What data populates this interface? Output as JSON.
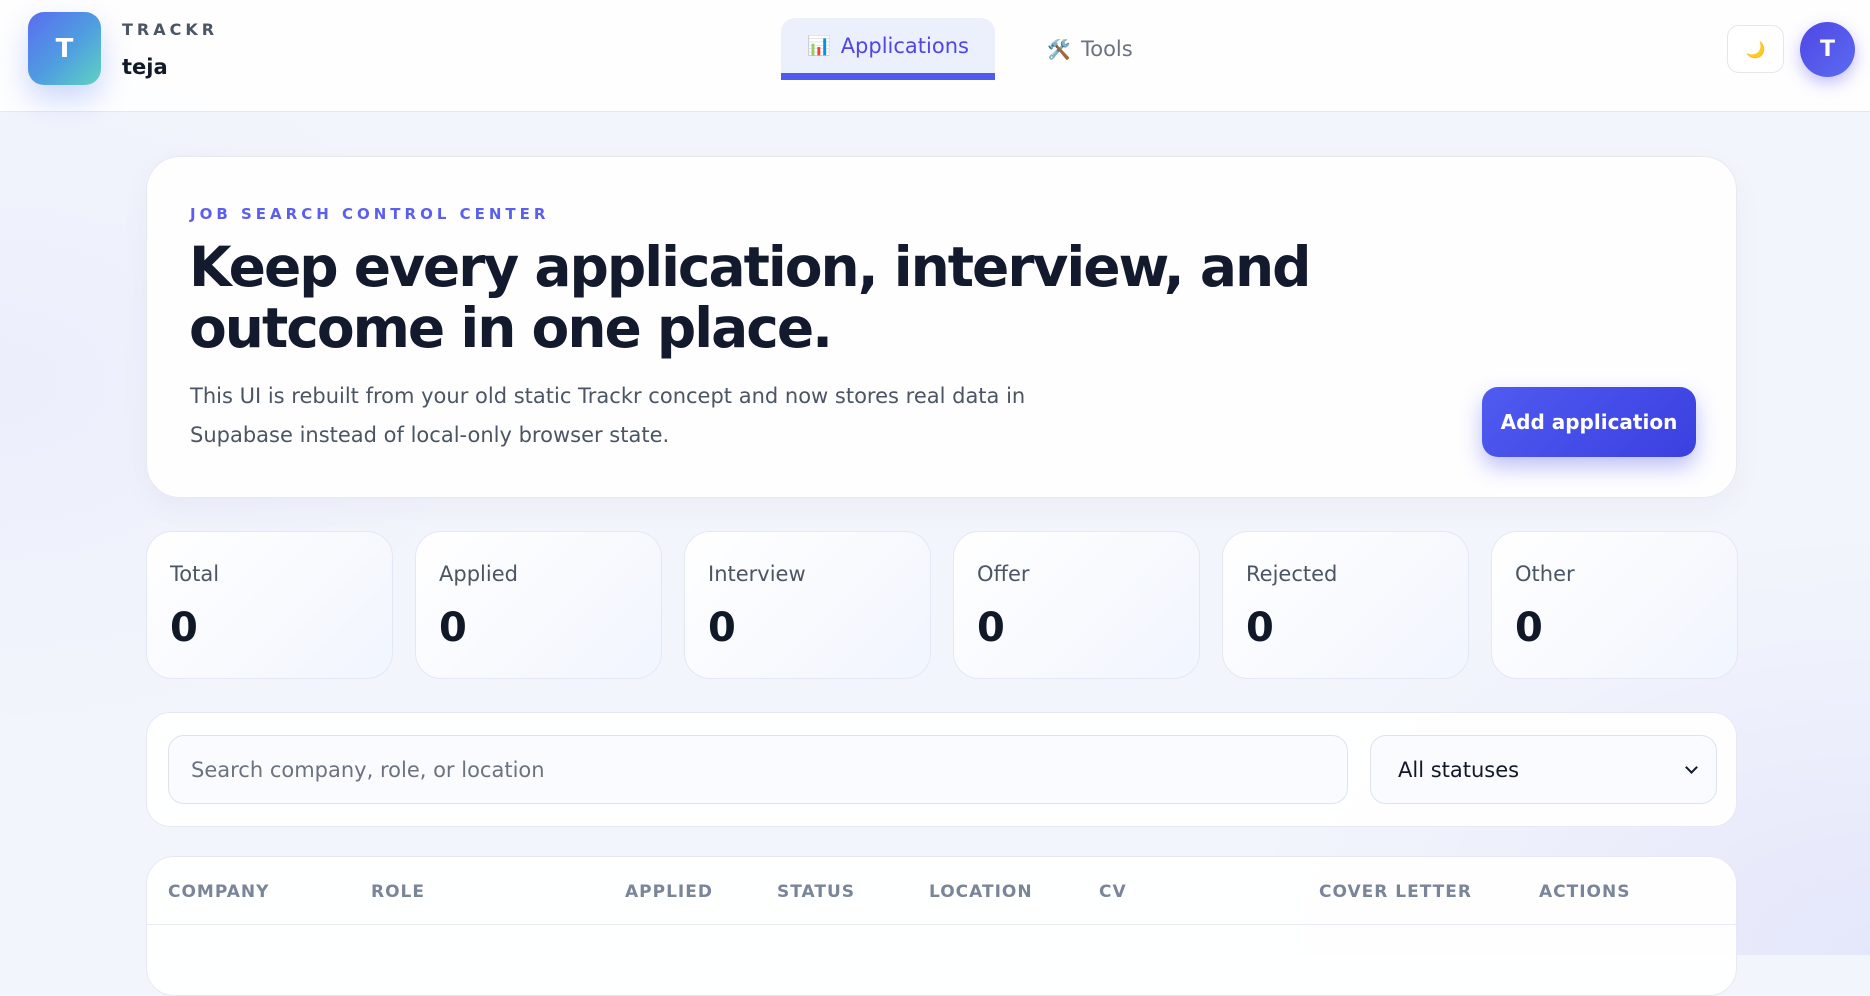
{
  "brand": {
    "logo_letter": "T",
    "kicker": "TRACKR",
    "user": "teja"
  },
  "nav": {
    "tabs": [
      {
        "icon": "📊",
        "label": "Applications",
        "active": true
      },
      {
        "icon": "🛠️",
        "label": "Tools",
        "active": false
      }
    ]
  },
  "header": {
    "theme_icon": "🌙",
    "avatar_letter": "T"
  },
  "hero": {
    "kicker": "JOB SEARCH CONTROL CENTER",
    "title": "Keep every application, interview, and outcome in one place.",
    "description": "This UI is rebuilt from your old static Trackr concept and now stores real data in Supabase instead of local-only browser state.",
    "add_button": "Add application"
  },
  "stats": [
    {
      "label": "Total",
      "value": "0"
    },
    {
      "label": "Applied",
      "value": "0"
    },
    {
      "label": "Interview",
      "value": "0"
    },
    {
      "label": "Offer",
      "value": "0"
    },
    {
      "label": "Rejected",
      "value": "0"
    },
    {
      "label": "Other",
      "value": "0"
    }
  ],
  "filters": {
    "search_placeholder": "Search company, role, or location",
    "status_selected": "All statuses"
  },
  "table": {
    "columns": [
      "COMPANY",
      "ROLE",
      "APPLIED",
      "STATUS",
      "LOCATION",
      "CV",
      "COVER LETTER",
      "ACTIONS"
    ]
  },
  "colors": {
    "accent": "#4f5bf0",
    "background": "#f3f5fc",
    "text": "#111827"
  }
}
